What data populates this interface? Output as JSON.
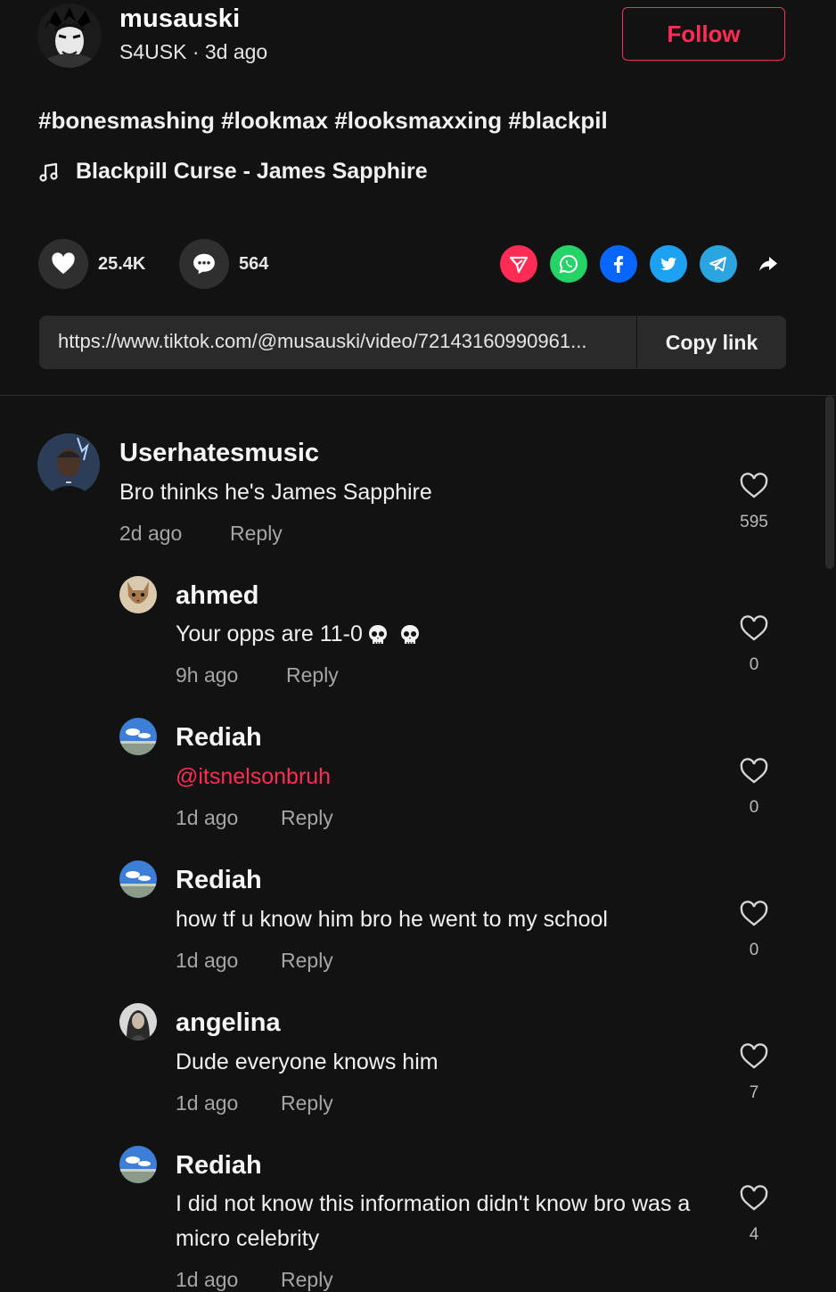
{
  "post": {
    "author_name": "musauski",
    "author_meta": "S4USK · 3d ago",
    "follow_label": "Follow",
    "caption": "#bonesmashing #lookmax #looksmaxxing #blackpil",
    "music": "Blackpill Curse - James Sapphire",
    "like_count": "25.4K",
    "comment_count": "564",
    "link_url": "https://www.tiktok.com/@musauski/video/72143160990961...",
    "copy_link_label": "Copy link"
  },
  "share_icons": [
    "send-icon",
    "whatsapp-icon",
    "facebook-icon",
    "twitter-icon",
    "telegram-icon",
    "share-arrow-icon"
  ],
  "colors": {
    "accent": "#fe2c55",
    "whatsapp": "#25d366",
    "facebook": "#0866ff",
    "twitter": "#1da1f2",
    "telegram": "#2aa5e0",
    "background": "#121212"
  },
  "comments": [
    {
      "user": "Userhatesmusic",
      "text": "Bro thinks he's James Sapphire",
      "time": "2d ago",
      "reply": "Reply",
      "likes": "595"
    },
    {
      "user": "ahmed",
      "text": "Your opps are 11-0",
      "time": "9h ago",
      "reply": "Reply",
      "likes": "0"
    },
    {
      "user": "Rediah",
      "text": "@itsnelsonbruh",
      "time": "1d ago",
      "reply": "Reply",
      "likes": "0"
    },
    {
      "user": "Rediah",
      "text": "how tf u know him bro he went to my school",
      "time": "1d ago",
      "reply": "Reply",
      "likes": "0"
    },
    {
      "user": "angelina",
      "text": "Dude everyone knows him",
      "time": "1d ago",
      "reply": "Reply",
      "likes": "7"
    },
    {
      "user": "Rediah",
      "text": "I did not know this information didn't know bro was a micro celebrity",
      "time": "1d ago",
      "reply": "Reply",
      "likes": "4"
    }
  ]
}
